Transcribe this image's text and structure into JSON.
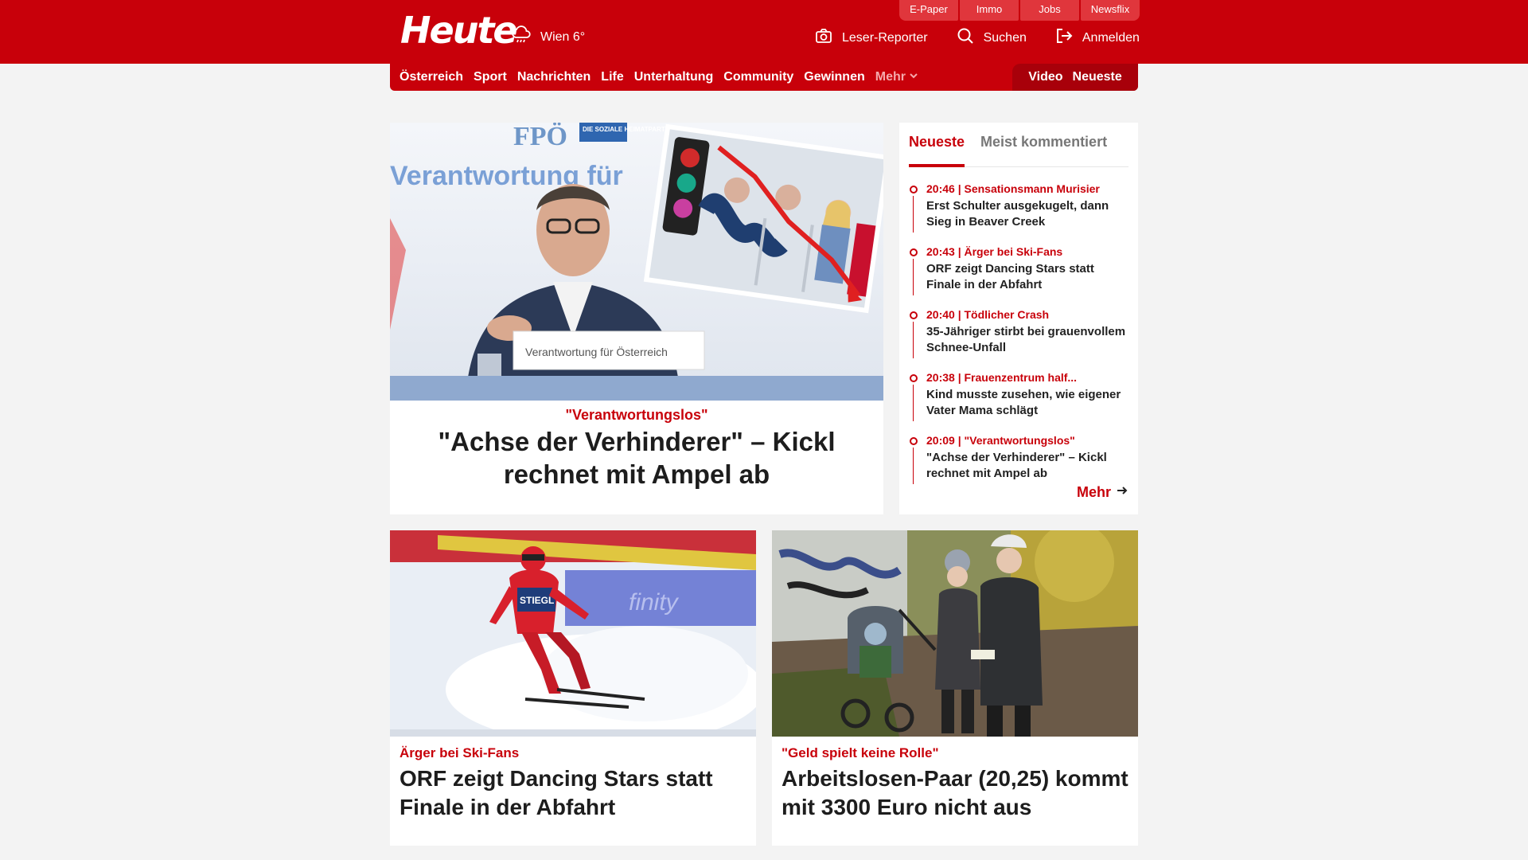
{
  "header": {
    "logo": "Heute",
    "weather": "Wien 6°",
    "service_tabs": [
      "E-Paper",
      "Immo",
      "Jobs",
      "Newsflix"
    ],
    "actions": {
      "reporter": "Leser-Reporter",
      "search": "Suchen",
      "login": "Anmelden"
    }
  },
  "nav": {
    "items": [
      "Österreich",
      "Sport",
      "Nachrichten",
      "Life",
      "Unterhaltung",
      "Community",
      "Gewinnen"
    ],
    "more": "Mehr",
    "video": "Video",
    "latest": "Neueste"
  },
  "lead": {
    "kicker": "\"Verantwortungslos\"",
    "headline": "\"Achse der Verhinderer\" – Kickl rechnet mit Ampel ab",
    "image_texts": {
      "banner": "Verantwortung für",
      "party": "FPÖ",
      "party_sub": "DIE SOZIALE HEIMATPARTEI",
      "lectern": "Verantwortung für Österreich"
    }
  },
  "sidebar": {
    "tabs": [
      "Neueste",
      "Meist kommentiert"
    ],
    "items": [
      {
        "meta": "20:46 | Sensationsmann Murisier",
        "title": "Erst Schulter ausgekugelt, dann Sieg in Beaver Creek"
      },
      {
        "meta": "20:43 | Ärger bei Ski-Fans",
        "title": "ORF zeigt Dancing Stars statt Finale in der Abfahrt"
      },
      {
        "meta": "20:40 | Tödlicher Crash",
        "title": "35-Jähriger stirbt bei grauenvollem Schnee-Unfall"
      },
      {
        "meta": "20:38 | Frauenzentrum half...",
        "title": "Kind musste zusehen, wie eigener Vater Mama schlägt"
      },
      {
        "meta": "20:09 | \"Verantwortungslos\"",
        "title": "\"Achse der Verhinderer\" – Kickl rechnet mit Ampel ab"
      }
    ],
    "more": "Mehr"
  },
  "cards": [
    {
      "kicker": "Ärger bei Ski-Fans",
      "headline": "ORF zeigt Dancing Stars statt Finale in der Abfahrt",
      "image_text": "STIEGL"
    },
    {
      "kicker": "\"Geld spielt keine Rolle\"",
      "headline": "Arbeitslosen-Paar (20,25) kommt mit 3300 Euro nicht aus"
    }
  ],
  "colors": {
    "brand_red": "#c8000a",
    "dark_red": "#a8000a",
    "page_bg": "#f3f3f3"
  },
  "icons": [
    "weather-rain-icon",
    "camera-icon",
    "search-icon",
    "login-icon",
    "chevron-down-icon",
    "arrow-right-icon"
  ]
}
